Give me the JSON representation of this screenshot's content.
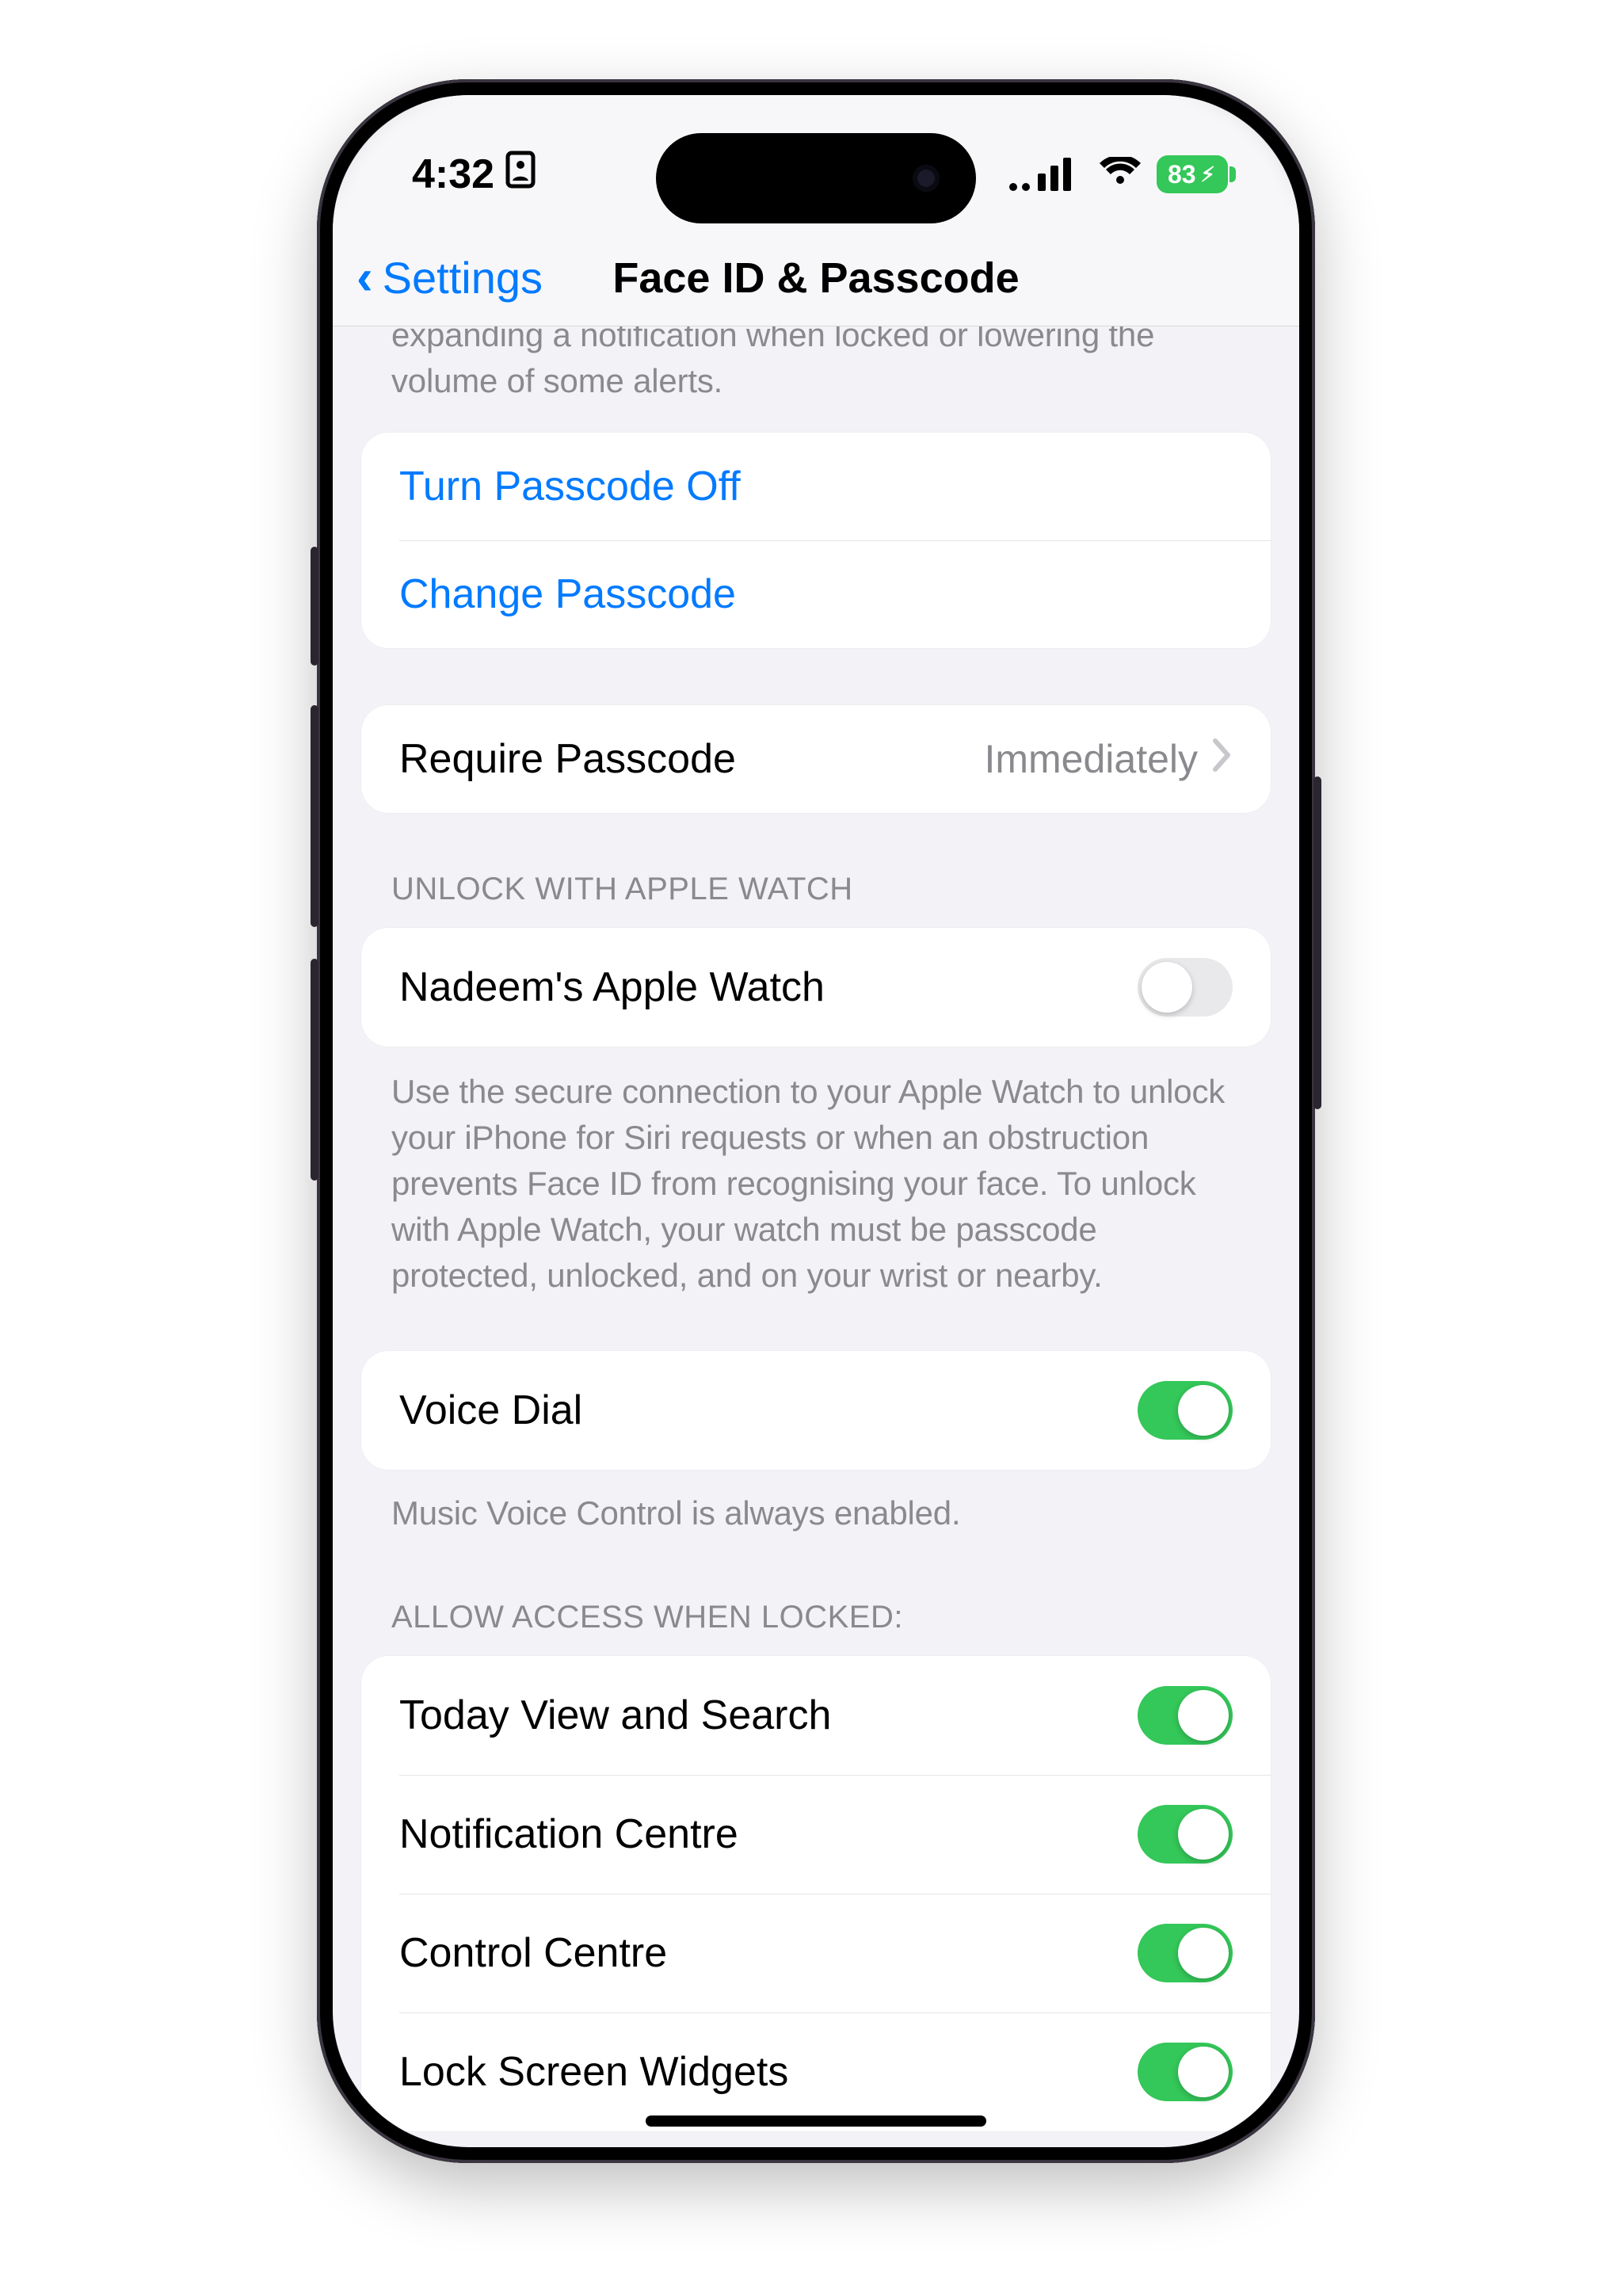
{
  "status": {
    "time": "4:32",
    "battery": "83"
  },
  "nav": {
    "back": "Settings",
    "title": "Face ID & Passcode"
  },
  "attention_footer": "iPhone will check for attention before dimming the display, expanding a notification when locked or lowering the volume of some alerts.",
  "passcode": {
    "turn_off": "Turn Passcode Off",
    "change": "Change Passcode",
    "require_label": "Require Passcode",
    "require_value": "Immediately"
  },
  "watch": {
    "header": "UNLOCK WITH APPLE WATCH",
    "row_label": "Nadeem's Apple Watch",
    "row_on": false,
    "footer": "Use the secure connection to your Apple Watch to unlock your iPhone for Siri requests or when an obstruction prevents Face ID from recognising your face. To unlock with Apple Watch, your watch must be passcode protected, unlocked, and on your wrist or nearby."
  },
  "voice": {
    "label": "Voice Dial",
    "on": true,
    "footer": "Music Voice Control is always enabled."
  },
  "locked": {
    "header": "ALLOW ACCESS WHEN LOCKED:",
    "items": [
      {
        "label": "Today View and Search",
        "on": true
      },
      {
        "label": "Notification Centre",
        "on": true
      },
      {
        "label": "Control Centre",
        "on": true
      },
      {
        "label": "Lock Screen Widgets",
        "on": true
      }
    ]
  }
}
